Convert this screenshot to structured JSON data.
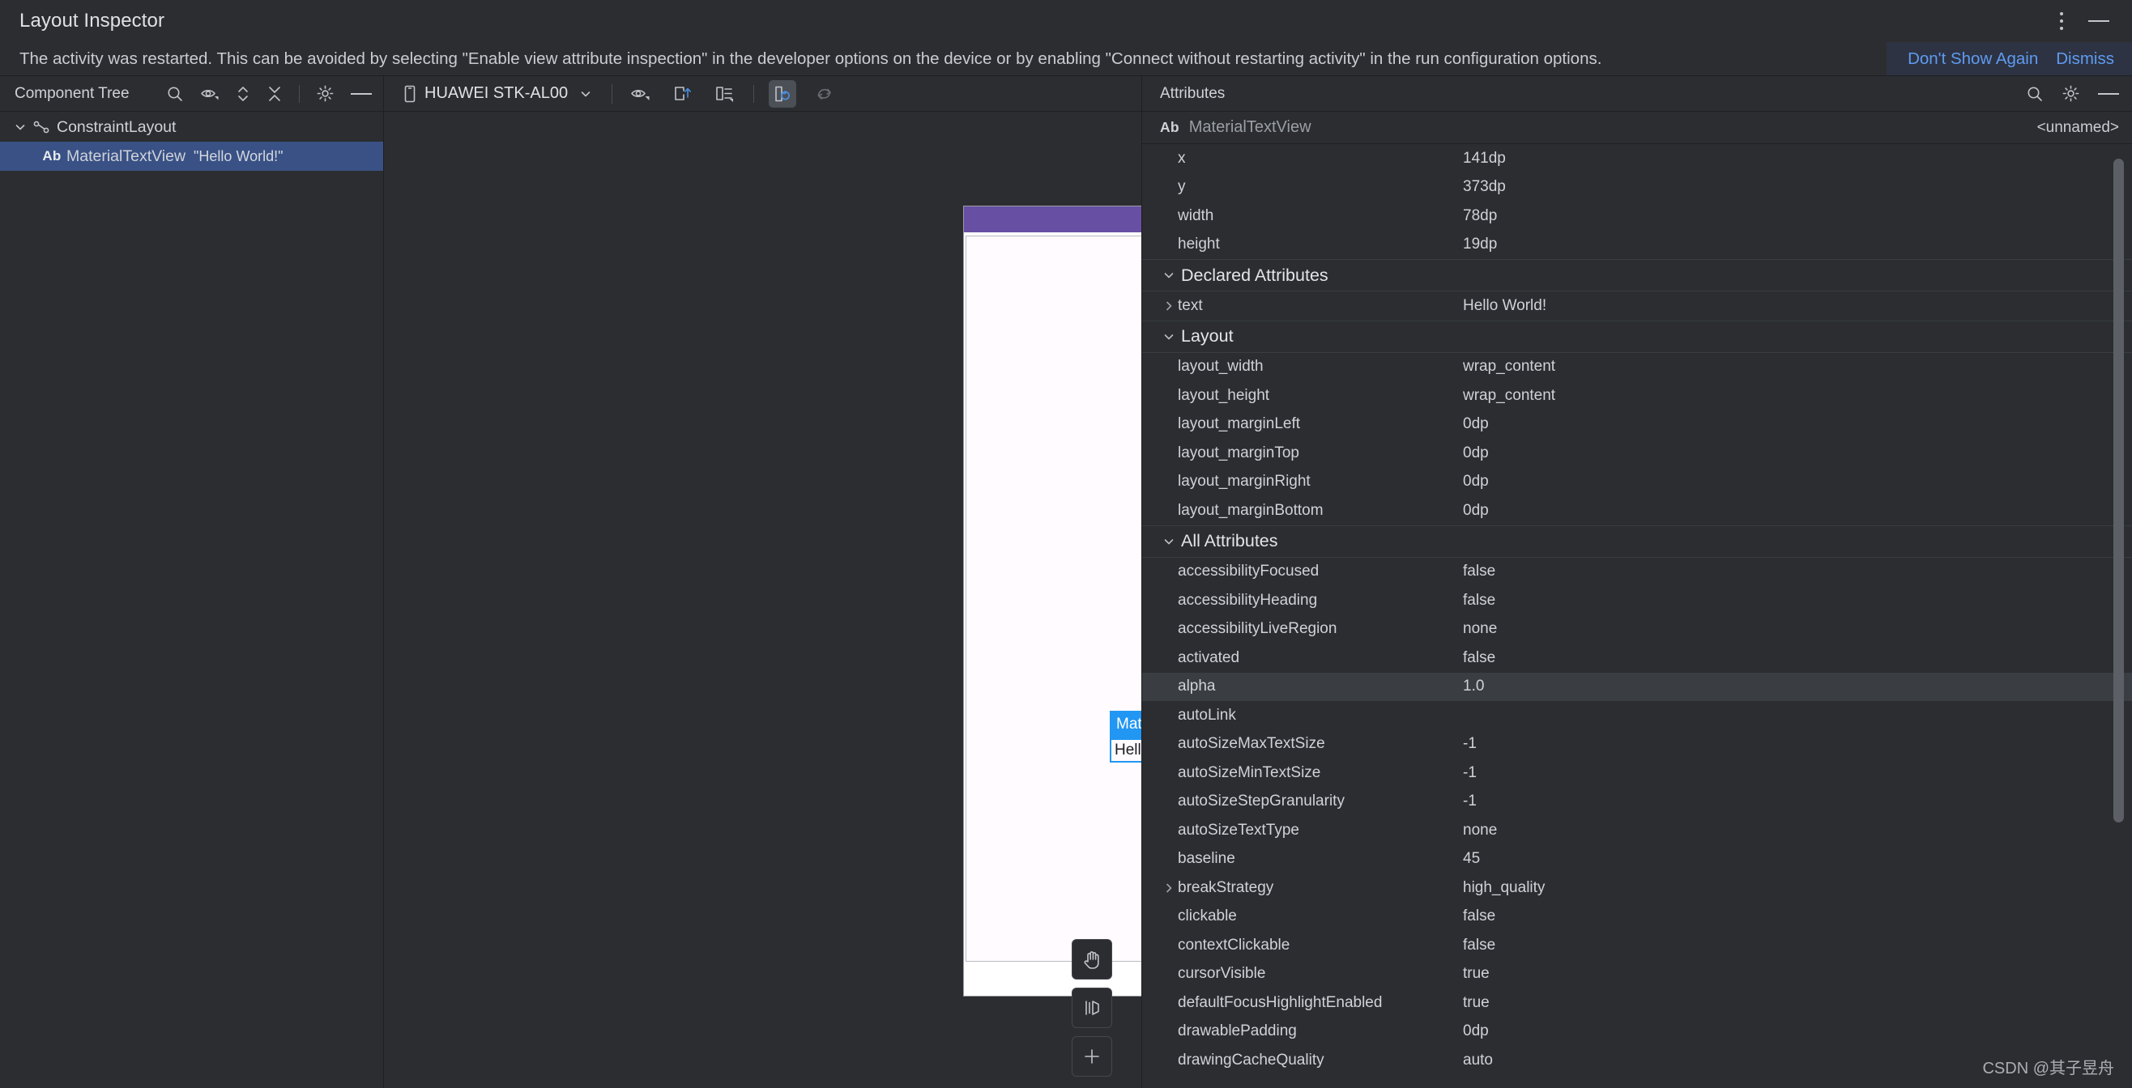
{
  "window": {
    "title": "Layout Inspector",
    "icons": {
      "more": "kebab-menu-icon",
      "minimize": "minimize-icon"
    }
  },
  "banner": {
    "message": "The activity was restarted. This can be avoided by selecting \"Enable view attribute inspection\" in the developer options on the device or by enabling \"Connect without restarting activity\" in the run configuration options.",
    "dont_show_again": "Don't Show Again",
    "dismiss": "Dismiss"
  },
  "component_tree": {
    "title": "Component Tree",
    "icons": [
      "search-icon",
      "eye-filter-icon",
      "expand-collapse-icon",
      "close-all-icon",
      "gear-icon",
      "minimize-icon"
    ],
    "nodes": [
      {
        "label": "ConstraintLayout",
        "sub": "",
        "icon": "constraint-layout-icon",
        "depth": 0,
        "expanded": true,
        "selected": false
      },
      {
        "label": "MaterialTextView",
        "sub": "\"Hello World!\"",
        "icon": "text-view-icon",
        "depth": 1,
        "expanded": false,
        "selected": true
      }
    ]
  },
  "device_toolbar": {
    "device_name": "HUAWEI STK-AL00",
    "device_icon": "phone-icon",
    "caret": "chevron-down-icon",
    "buttons": [
      {
        "name": "view-options-icon",
        "active": false,
        "disabled": false
      },
      {
        "name": "load-overlay-icon",
        "active": false,
        "disabled": false
      },
      {
        "name": "layer-spacing-icon",
        "active": false,
        "disabled": false
      },
      {
        "name": "live-updates-icon",
        "active": true,
        "disabled": false
      },
      {
        "name": "refresh-icon",
        "active": false,
        "disabled": true
      }
    ]
  },
  "preview": {
    "selection_label": "MaterialTextView",
    "selection_text": "Hello World",
    "statusbar_color": "#6750a4",
    "surface_color": "#fffbfe",
    "selection_color": "#2196f3",
    "fabs": [
      "pan-hand-icon",
      "rotate-3d-icon",
      "zoom-in-icon"
    ]
  },
  "attributes": {
    "title": "Attributes",
    "icons": [
      "search-icon",
      "gear-icon",
      "minimize-icon"
    ],
    "selected_node": {
      "badge": "Ab",
      "class_name": "MaterialTextView",
      "id": "<unnamed>"
    },
    "rows": [
      {
        "type": "attr",
        "key": "x",
        "value": "141dp",
        "expandable": false
      },
      {
        "type": "attr",
        "key": "y",
        "value": "373dp",
        "expandable": false
      },
      {
        "type": "attr",
        "key": "width",
        "value": "78dp",
        "expandable": false
      },
      {
        "type": "attr",
        "key": "height",
        "value": "19dp",
        "expandable": false
      },
      {
        "type": "group",
        "key": "Declared Attributes",
        "value": "",
        "expandable": true
      },
      {
        "type": "attr",
        "key": "text",
        "value": "Hello World!",
        "expandable": true
      },
      {
        "type": "group",
        "key": "Layout",
        "value": "",
        "expandable": true
      },
      {
        "type": "attr",
        "key": "layout_width",
        "value": "wrap_content",
        "expandable": false
      },
      {
        "type": "attr",
        "key": "layout_height",
        "value": "wrap_content",
        "expandable": false
      },
      {
        "type": "attr",
        "key": "layout_marginLeft",
        "value": "0dp",
        "expandable": false
      },
      {
        "type": "attr",
        "key": "layout_marginTop",
        "value": "0dp",
        "expandable": false
      },
      {
        "type": "attr",
        "key": "layout_marginRight",
        "value": "0dp",
        "expandable": false
      },
      {
        "type": "attr",
        "key": "layout_marginBottom",
        "value": "0dp",
        "expandable": false
      },
      {
        "type": "group",
        "key": "All Attributes",
        "value": "",
        "expandable": true
      },
      {
        "type": "attr",
        "key": "accessibilityFocused",
        "value": "false",
        "expandable": false
      },
      {
        "type": "attr",
        "key": "accessibilityHeading",
        "value": "false",
        "expandable": false
      },
      {
        "type": "attr",
        "key": "accessibilityLiveRegion",
        "value": "none",
        "expandable": false
      },
      {
        "type": "attr",
        "key": "activated",
        "value": "false",
        "expandable": false
      },
      {
        "type": "attr",
        "key": "alpha",
        "value": "1.0",
        "expandable": false,
        "highlight": true
      },
      {
        "type": "attr",
        "key": "autoLink",
        "value": "",
        "expandable": false
      },
      {
        "type": "attr",
        "key": "autoSizeMaxTextSize",
        "value": "-1",
        "expandable": false
      },
      {
        "type": "attr",
        "key": "autoSizeMinTextSize",
        "value": "-1",
        "expandable": false
      },
      {
        "type": "attr",
        "key": "autoSizeStepGranularity",
        "value": "-1",
        "expandable": false
      },
      {
        "type": "attr",
        "key": "autoSizeTextType",
        "value": "none",
        "expandable": false
      },
      {
        "type": "attr",
        "key": "baseline",
        "value": "45",
        "expandable": false
      },
      {
        "type": "attr",
        "key": "breakStrategy",
        "value": "high_quality",
        "expandable": true
      },
      {
        "type": "attr",
        "key": "clickable",
        "value": "false",
        "expandable": false
      },
      {
        "type": "attr",
        "key": "contextClickable",
        "value": "false",
        "expandable": false
      },
      {
        "type": "attr",
        "key": "cursorVisible",
        "value": "true",
        "expandable": false
      },
      {
        "type": "attr",
        "key": "defaultFocusHighlightEnabled",
        "value": "true",
        "expandable": false
      },
      {
        "type": "attr",
        "key": "drawablePadding",
        "value": "0dp",
        "expandable": false
      },
      {
        "type": "attr",
        "key": "drawingCacheQuality",
        "value": "auto",
        "expandable": false
      }
    ]
  },
  "watermark": "CSDN @其子昱舟"
}
